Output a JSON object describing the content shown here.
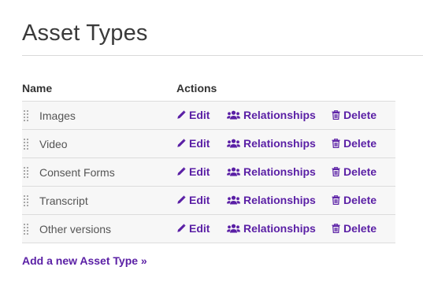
{
  "page": {
    "title": "Asset Types"
  },
  "table": {
    "columns": {
      "name": "Name",
      "actions": "Actions"
    },
    "rows": [
      {
        "name": "Images"
      },
      {
        "name": "Video"
      },
      {
        "name": "Consent Forms"
      },
      {
        "name": "Transcript"
      },
      {
        "name": "Other versions"
      }
    ],
    "actions": {
      "edit_label": "Edit",
      "relationships_label": "Relationships",
      "delete_label": "Delete"
    }
  },
  "footer": {
    "add_link_label": "Add a new Asset Type »"
  },
  "colors": {
    "link": "#5a1fa5",
    "row_background": "#f7f7f7",
    "divider": "#dcdcdc"
  },
  "icons": {
    "edit": "pencil-icon",
    "relationships": "users-icon",
    "delete": "trash-icon",
    "drag": "drag-handle-icon"
  }
}
